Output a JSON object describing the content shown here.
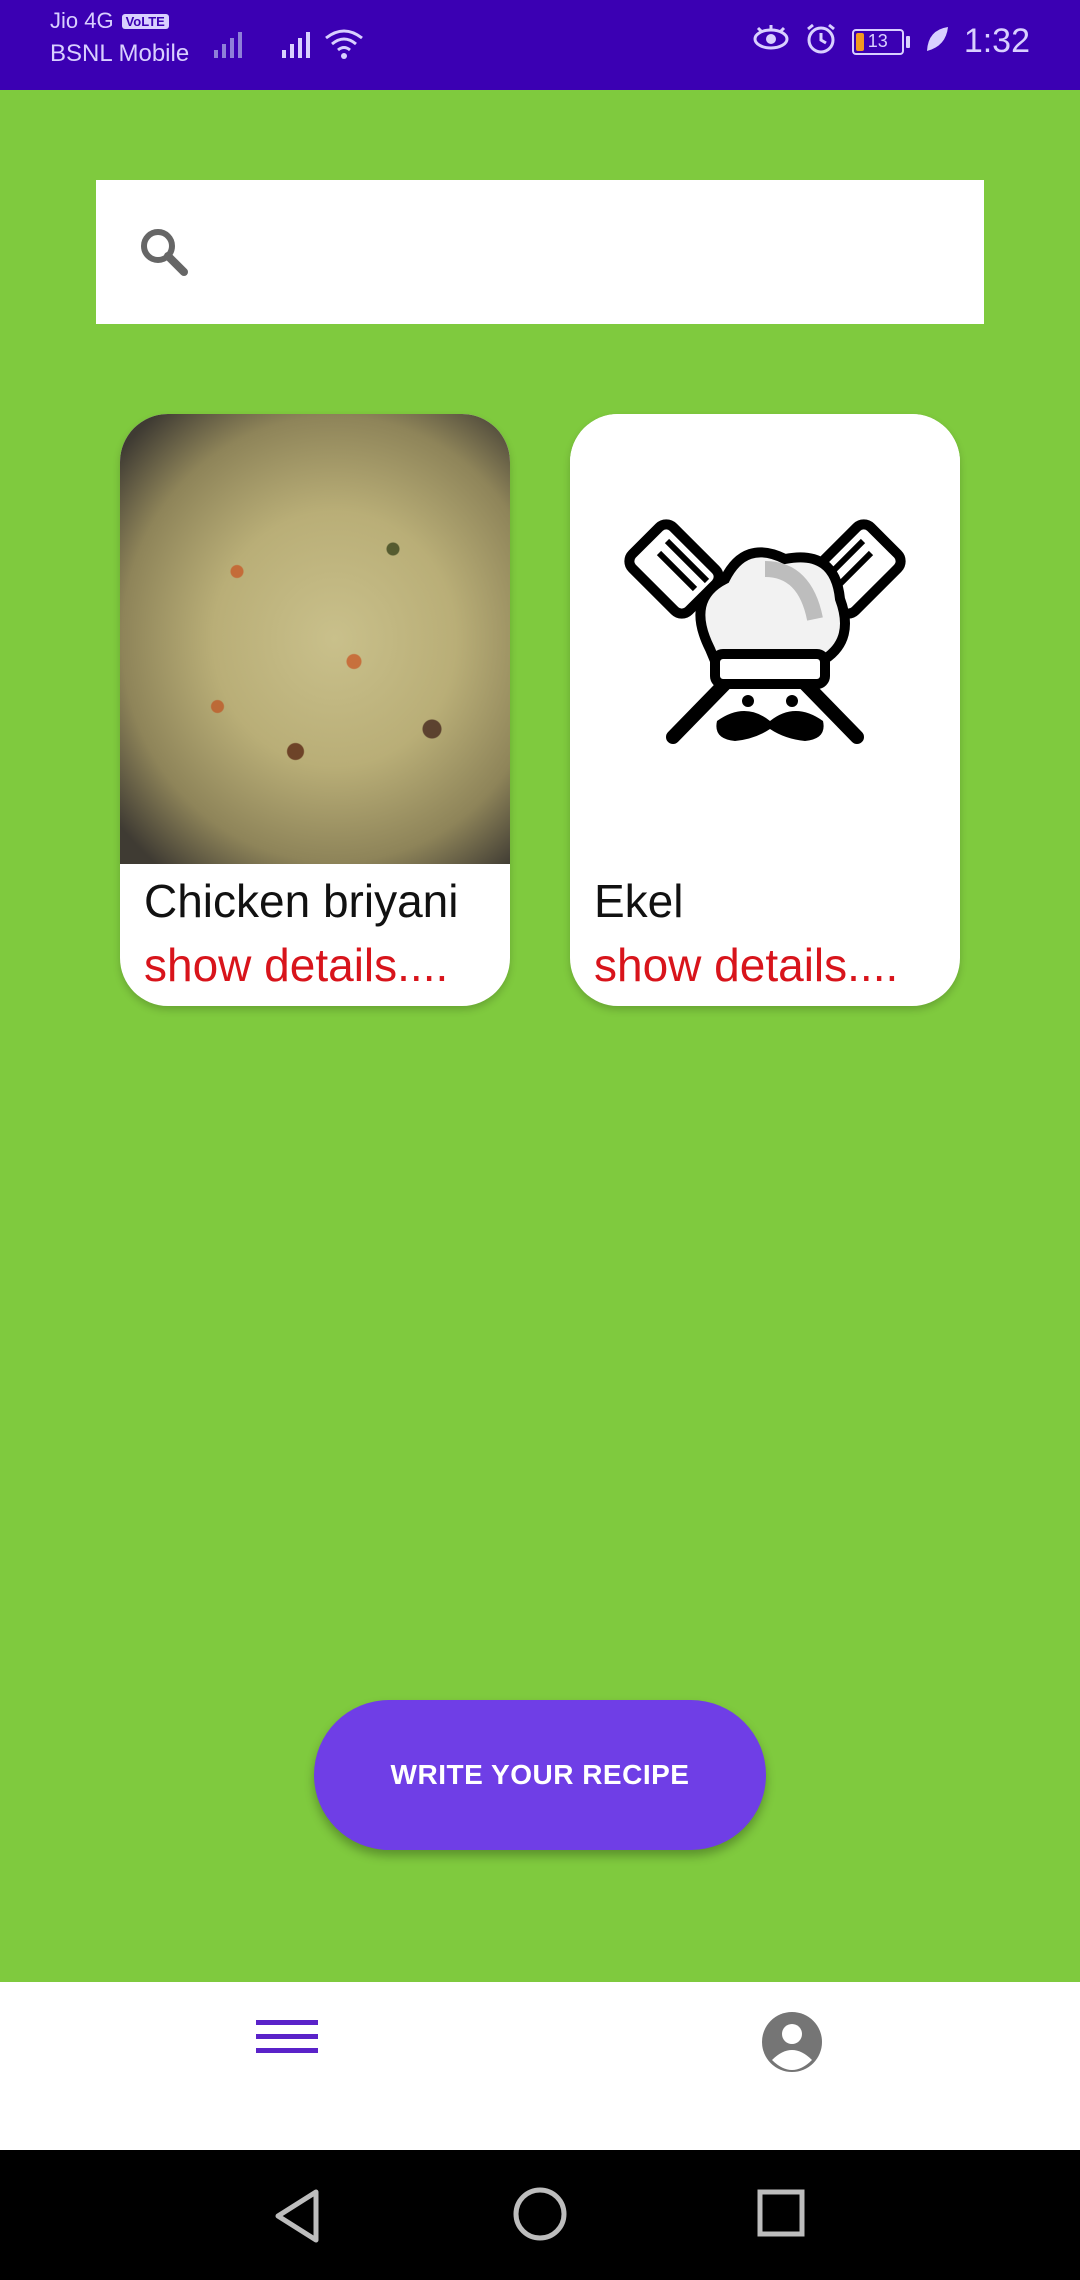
{
  "status_bar": {
    "carrier_primary": "Jio 4G",
    "volte_badge": "VoLTE",
    "carrier_secondary": "BSNL Mobile",
    "battery_level": "13",
    "time": "1:32",
    "icons": [
      "eye-comfort-icon",
      "alarm-icon",
      "battery-icon",
      "leaf-icon",
      "signal-icon",
      "wifi-icon"
    ]
  },
  "search": {
    "placeholder": "",
    "value": ""
  },
  "recipes": [
    {
      "title": "Chicken briyani",
      "link": "show details....",
      "image": "biryani-photo"
    },
    {
      "title": "Ekel",
      "link": "show details....",
      "image": "chef-logo"
    }
  ],
  "primary_action": {
    "label": "WRITE YOUR RECIPE"
  },
  "bottom_nav": {
    "items": [
      "menu-icon",
      "profile-icon"
    ]
  },
  "colors": {
    "status_bar": "#3B00B3",
    "background": "#7FCA3E",
    "accent": "#6F3EE6",
    "link": "#D8141B",
    "nav_icon": "#5A22C9"
  }
}
